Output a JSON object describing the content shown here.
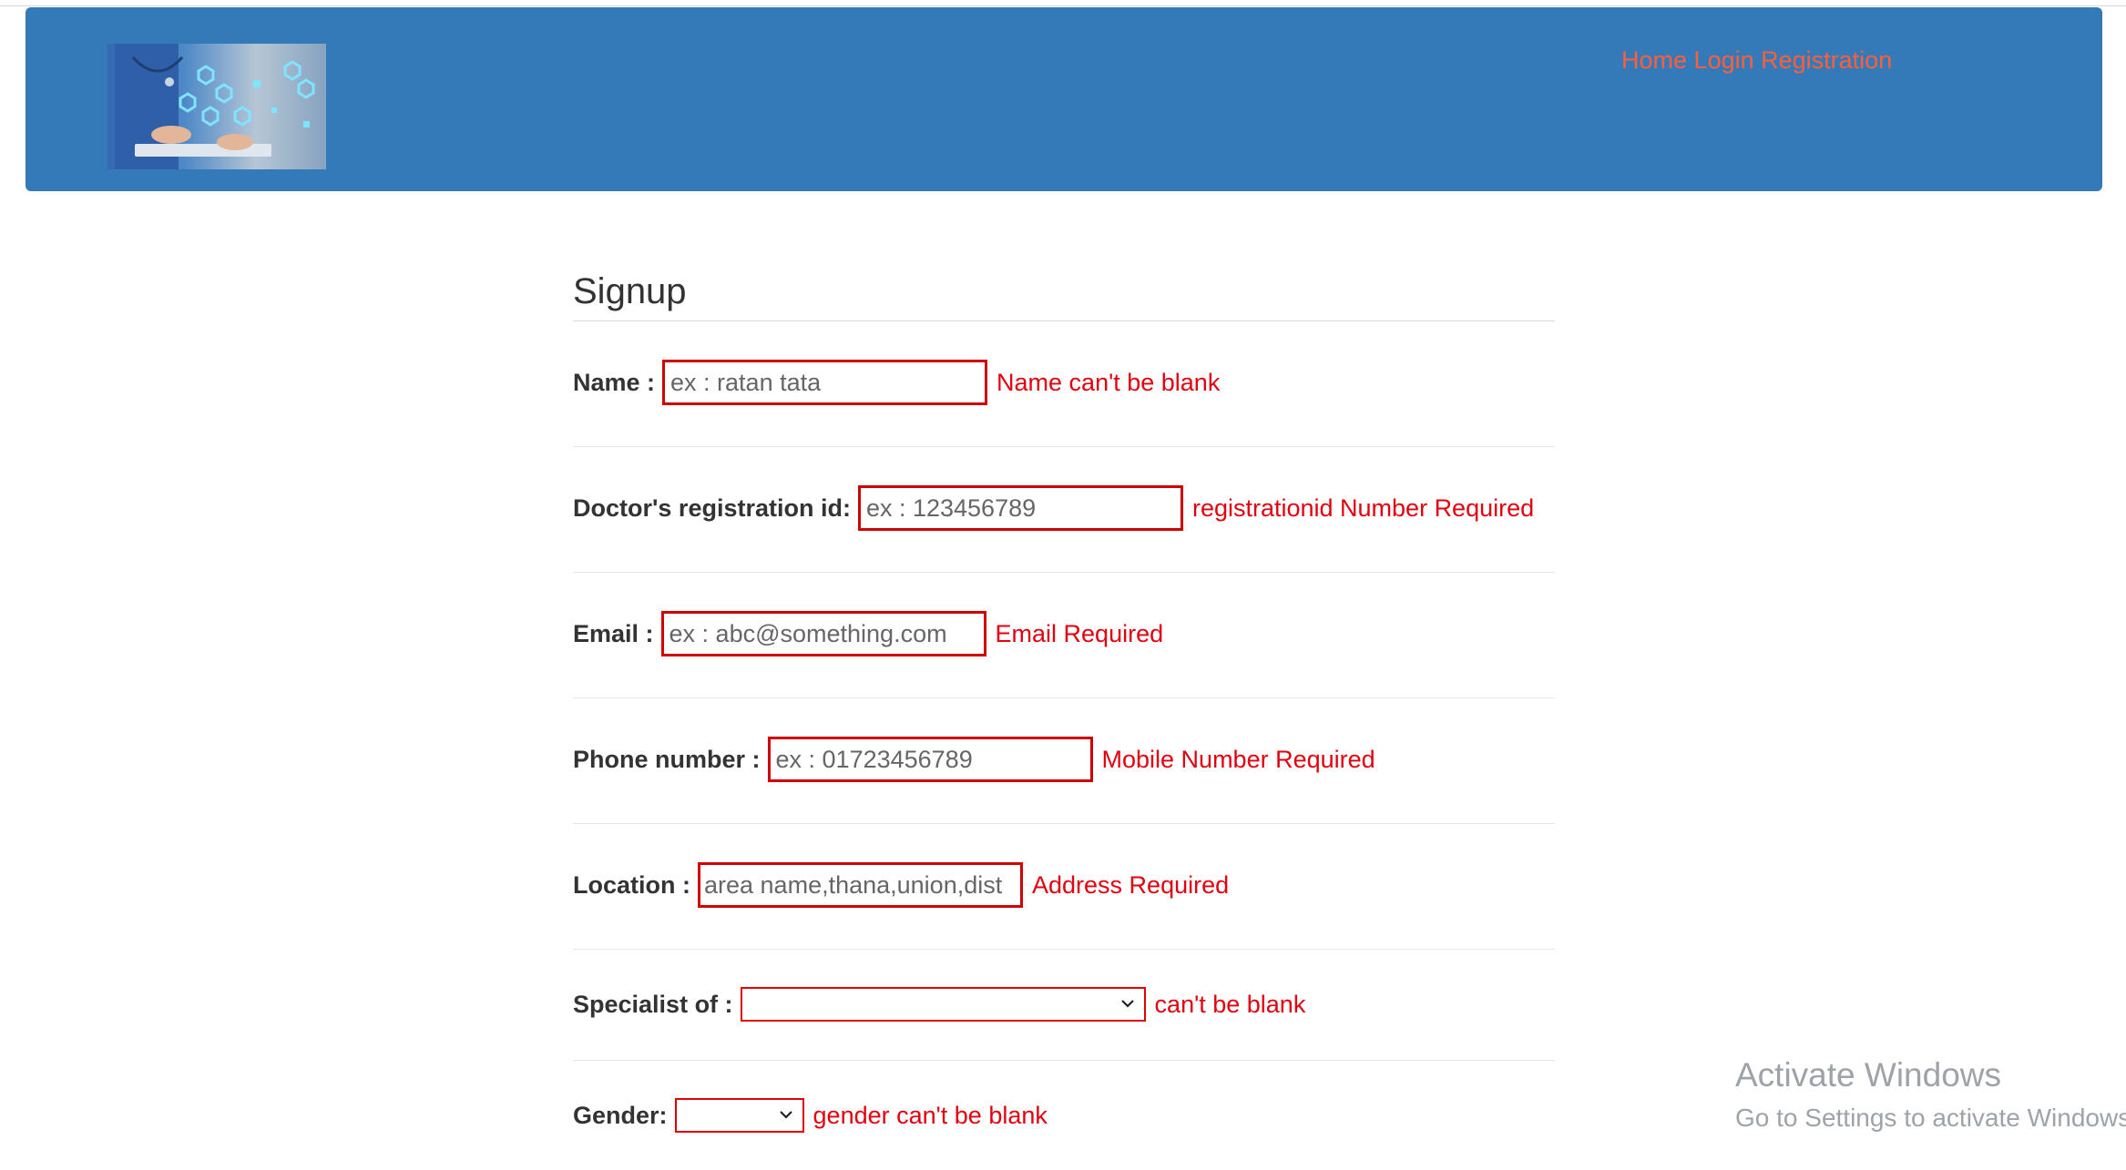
{
  "header": {
    "nav": {
      "home": "Home",
      "login": "Login",
      "registration": "Registration"
    }
  },
  "form": {
    "title": "Signup",
    "fields": [
      {
        "label": "Name :",
        "placeholder": "ex : ratan tata",
        "error": "Name can't be blank"
      },
      {
        "label": "Doctor's registration id:",
        "placeholder": "ex : 123456789",
        "error": "registrationid Number Required"
      },
      {
        "label": "Email :",
        "placeholder": "ex : abc@something.com",
        "error": "Email Required"
      },
      {
        "label": "Phone number :",
        "placeholder": "ex : 01723456789",
        "error": "Mobile Number Required"
      },
      {
        "label": "Location :",
        "placeholder": "area name,thana,union,dist",
        "error": "Address Required"
      },
      {
        "label": "Specialist of :",
        "selected": "",
        "error": "can't be blank"
      },
      {
        "label": "Gender:",
        "selected": "",
        "error": "gender can't be blank"
      }
    ]
  },
  "watermark": {
    "title": "Activate Windows",
    "subtitle": "Go to Settings to activate Windows."
  },
  "colors": {
    "header_bg": "#357ab8",
    "nav_link": "#ff5f3a",
    "error": "#e0000f",
    "input_border": "#d10000"
  }
}
